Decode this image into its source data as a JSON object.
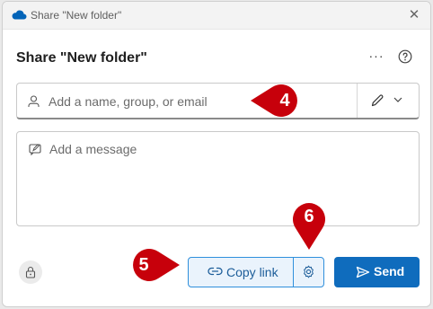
{
  "window": {
    "title": "Share \"New folder\""
  },
  "header": {
    "heading": "Share \"New folder\"",
    "more_label": "···"
  },
  "recipient": {
    "placeholder": "Add a name, group, or email"
  },
  "message": {
    "placeholder": "Add a message"
  },
  "actions": {
    "copy_link_label": "Copy link",
    "send_label": "Send"
  },
  "callouts": {
    "c4": "4",
    "c5": "5",
    "c6": "6"
  },
  "colors": {
    "accent": "#0f6cbd",
    "callout": "#c7000b",
    "copy_link_bg": "#eaf3fc"
  },
  "icons": [
    "onedrive-cloud-icon",
    "close-icon",
    "more-options-icon",
    "help-icon",
    "person-icon",
    "pencil-icon",
    "chevron-down-icon",
    "message-icon",
    "lock-icon",
    "link-icon",
    "gear-icon",
    "send-icon"
  ]
}
